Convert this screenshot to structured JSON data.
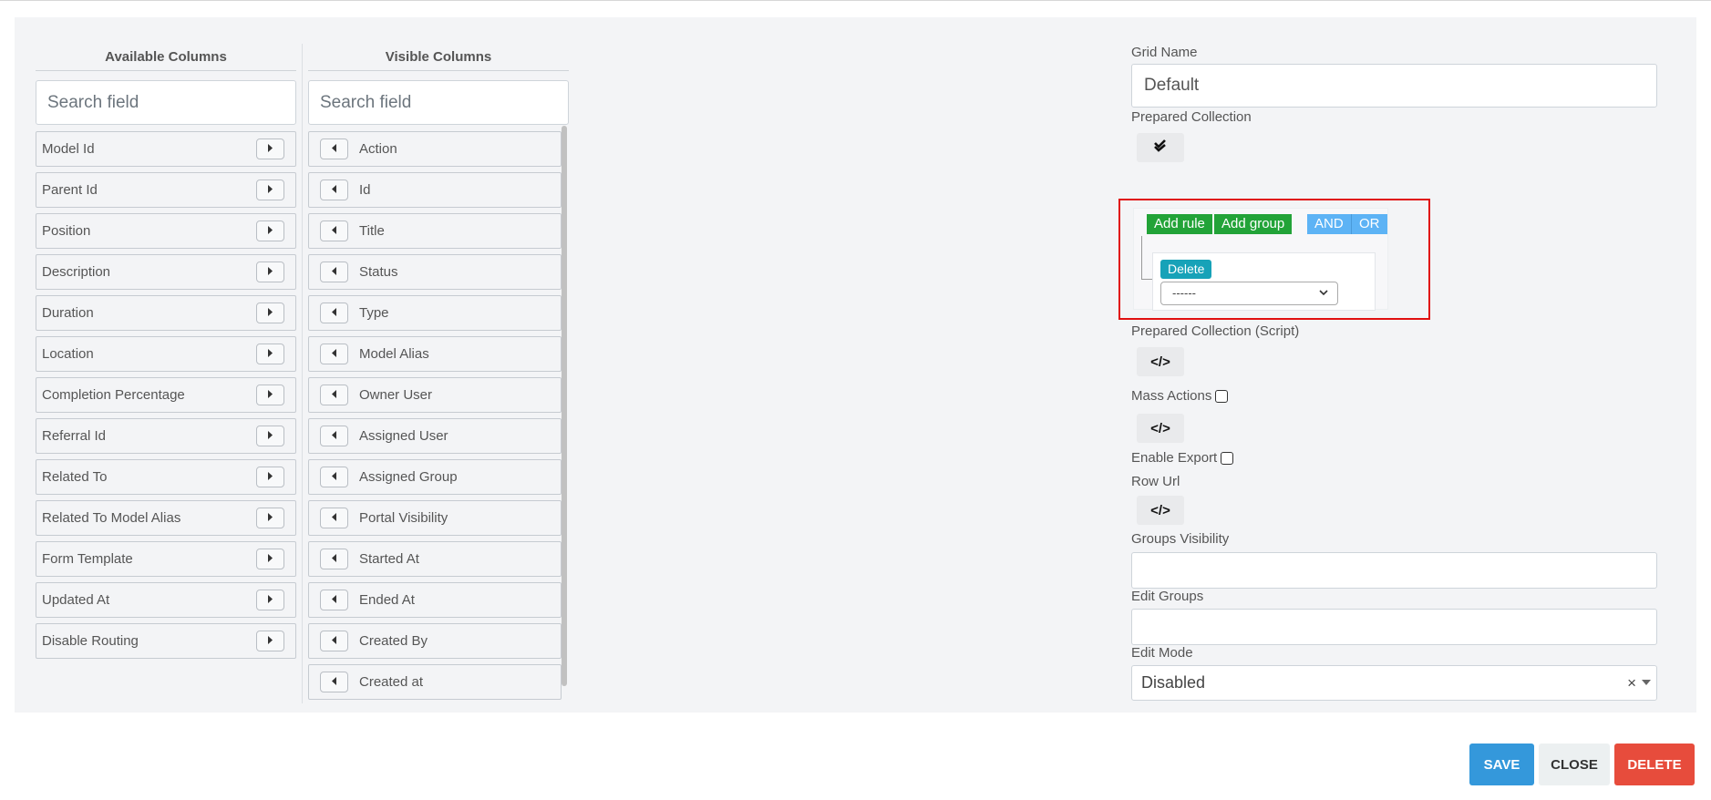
{
  "available_columns": {
    "header": "Available Columns",
    "search_placeholder": "Search field",
    "items": [
      "Model Id",
      "Parent Id",
      "Position",
      "Description",
      "Duration",
      "Location",
      "Completion Percentage",
      "Referral Id",
      "Related To",
      "Related To Model Alias",
      "Form Template",
      "Updated At",
      "Disable Routing"
    ]
  },
  "visible_columns": {
    "header": "Visible Columns",
    "search_placeholder": "Search field",
    "items": [
      "Action",
      "Id",
      "Title",
      "Status",
      "Type",
      "Model Alias",
      "Owner User",
      "Assigned User",
      "Assigned Group",
      "Portal Visibility",
      "Started At",
      "Ended At",
      "Created By",
      "Created at"
    ]
  },
  "form": {
    "grid_name_label": "Grid Name",
    "grid_name_value": "Default",
    "prepared_collection_label": "Prepared Collection",
    "query_builder": {
      "add_rule": "Add rule",
      "add_group": "Add group",
      "and": "AND",
      "or": "OR",
      "delete": "Delete",
      "select_value": "------"
    },
    "prepared_collection_script_label": "Prepared Collection (Script)",
    "mass_actions_label": "Mass Actions",
    "enable_export_label": "Enable Export",
    "row_url_label": "Row Url",
    "groups_visibility_label": "Groups Visibility",
    "groups_visibility_value": "",
    "edit_groups_label": "Edit Groups",
    "edit_groups_value": "",
    "edit_mode_label": "Edit Mode",
    "edit_mode_value": "Disabled",
    "code_glyph": "</>",
    "clear_glyph": "×"
  },
  "footer": {
    "save": "SAVE",
    "close": "CLOSE",
    "delete": "DELETE"
  },
  "colors": {
    "save": "#3498db",
    "delete": "#e74c3c",
    "qb_green": "#22a338",
    "qb_blue": "#5db3f5",
    "highlight": "#e01010"
  },
  "icons": {
    "move_right": "caret-right-icon",
    "move_left": "caret-left-icon",
    "prepared_collection": "double-check-icon",
    "script": "code-icon"
  }
}
